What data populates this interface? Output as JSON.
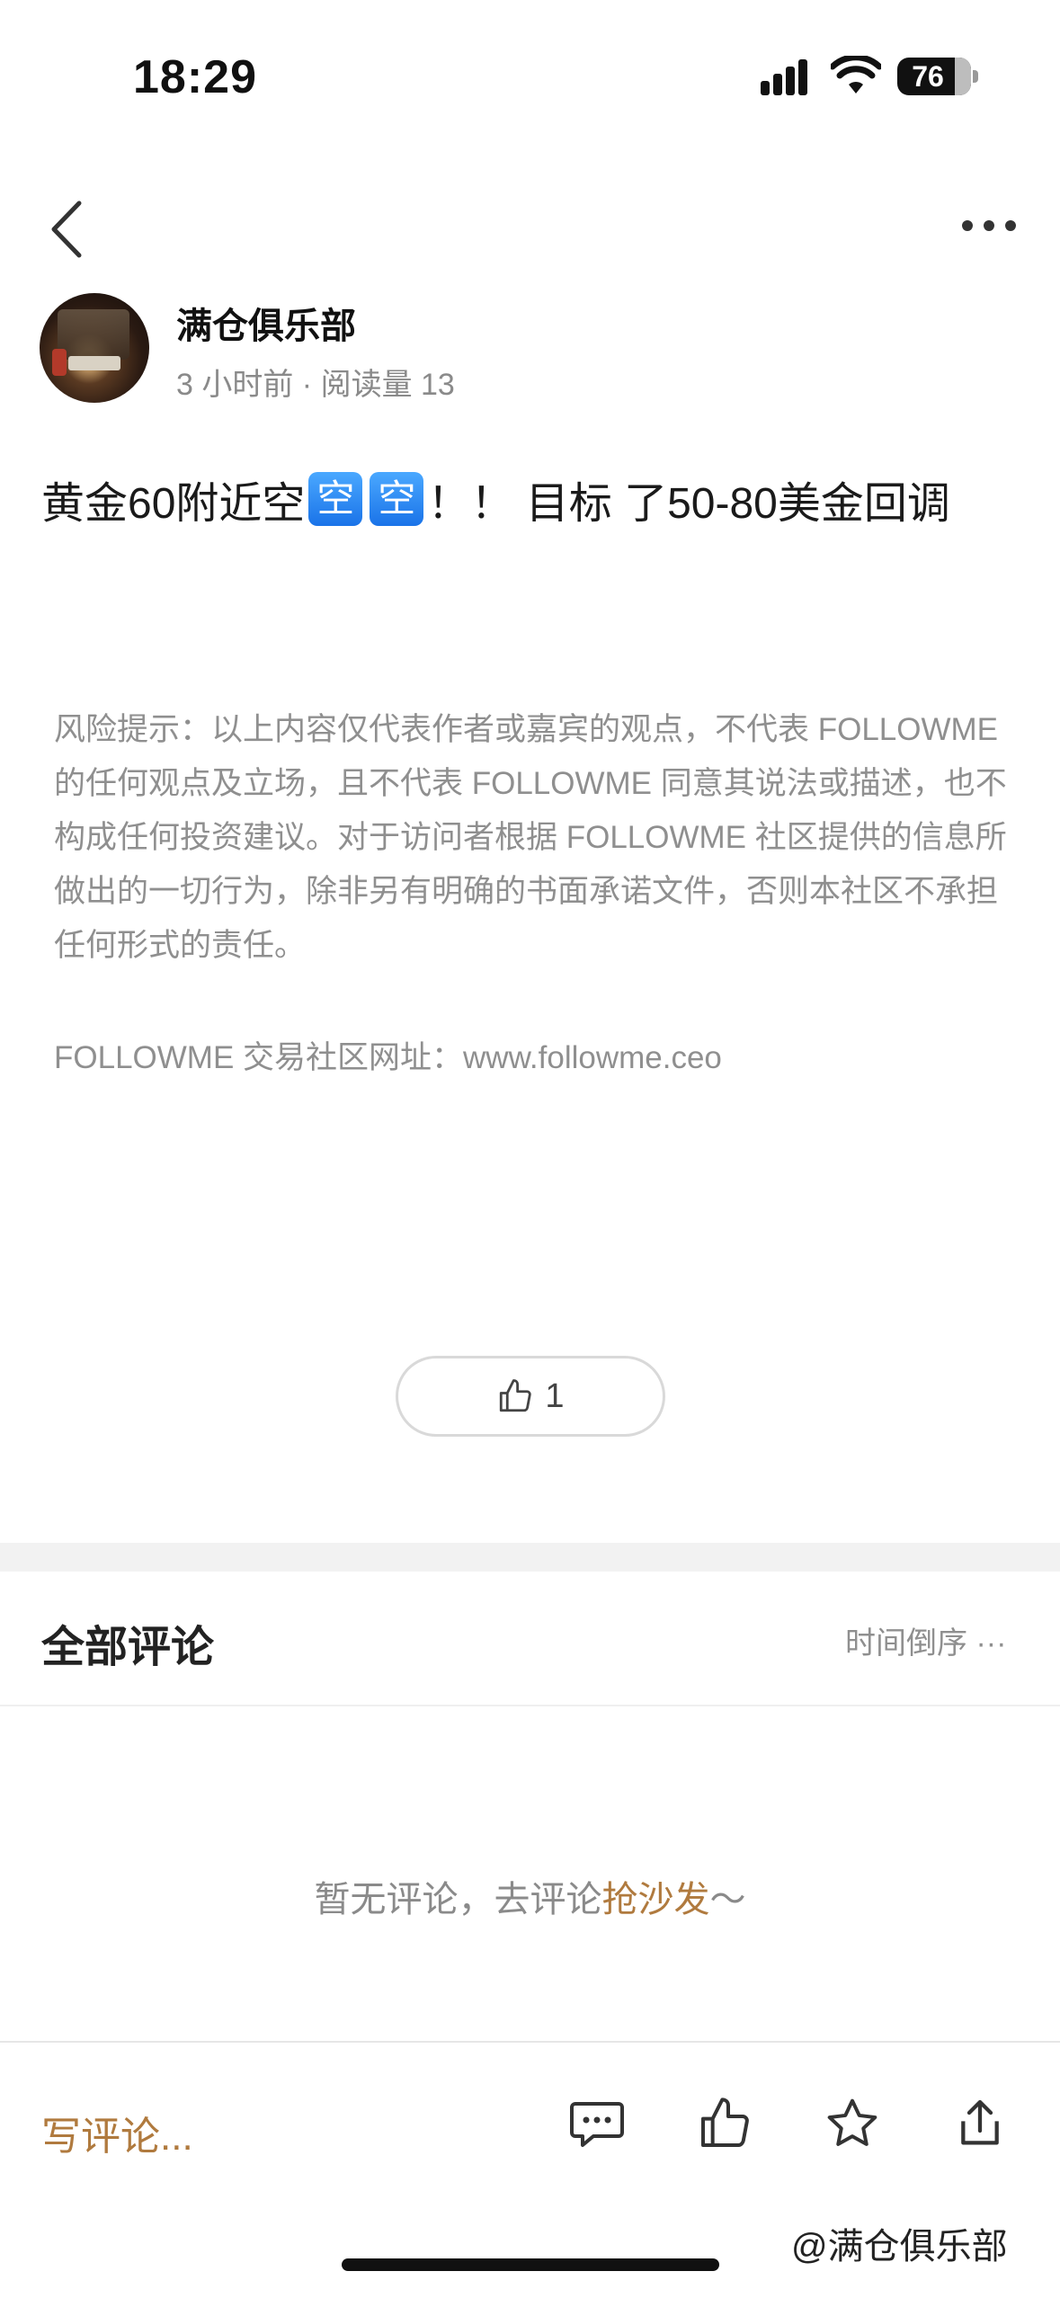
{
  "status": {
    "time": "18:29",
    "battery": "76"
  },
  "author": {
    "name": "满仓俱乐部",
    "meta": "3 小时前 · 阅读量 13"
  },
  "post": {
    "text_before": "黄金60附近空",
    "emoji": "空",
    "text_after": "！！ 目标 了50-80美金回调"
  },
  "disclaimer": "风险提示：以上内容仅代表作者或嘉宾的观点，不代表 FOLLOWME 的任何观点及立场，且不代表 FOLLOWME 同意其说法或描述，也不构成任何投资建议。对于访问者根据 FOLLOWME 社区提供的信息所做出的一切行为，除非另有明确的书面承诺文件，否则本社区不承担任何形式的责任。",
  "site": "FOLLOWME 交易社区网址：www.followme.ceo",
  "likes": "1",
  "comments": {
    "title": "全部评论",
    "sort": "时间倒序 ···",
    "empty_prefix": "暂无评论，去评论",
    "empty_link": "抢沙发",
    "empty_suffix": "～"
  },
  "bottom": {
    "write_placeholder": "写评论..."
  },
  "watermark": "@满仓俱乐部",
  "icons": [
    "back-icon",
    "more-icon",
    "thumbs-up-icon",
    "comment-icon",
    "star-icon",
    "share-icon"
  ],
  "colors": {
    "accent": "#b07a3e",
    "muted": "#8f8f8f"
  }
}
